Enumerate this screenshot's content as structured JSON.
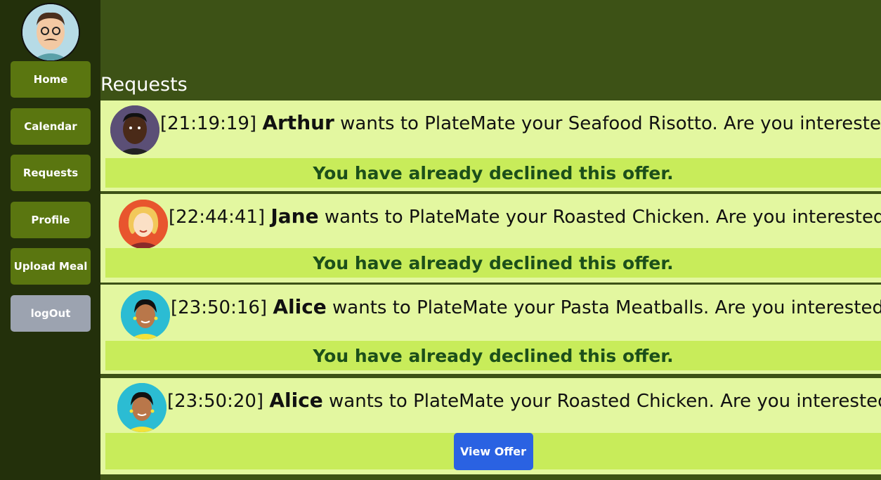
{
  "sidebar": {
    "nav": [
      {
        "label": "Home"
      },
      {
        "label": "Calendar"
      },
      {
        "label": "Requests"
      },
      {
        "label": "Profile"
      },
      {
        "label": "Upload Meal"
      },
      {
        "label": "logOut"
      }
    ]
  },
  "page": {
    "title": "Requests"
  },
  "requests": [
    {
      "time": "[21:19:19]",
      "name": "Arthur",
      "text": "wants to PlateMate your Seafood Risotto. Are you interested?",
      "status": "You have already declined this offer."
    },
    {
      "time": "[22:44:41]",
      "name": "Jane",
      "text": "wants to PlateMate your Roasted Chicken. Are you interested?",
      "status": "You have already declined this offer."
    },
    {
      "time": "[23:50:16]",
      "name": "Alice",
      "text": "wants to PlateMate your Pasta Meatballs. Are you interested?",
      "status": "You have already declined this offer."
    },
    {
      "time": "[23:50:20]",
      "name": "Alice",
      "text": "wants to PlateMate your Roasted Chicken. Are you interested?",
      "button": "View Offer"
    }
  ],
  "colors": {
    "sidebar": "#23300b",
    "header": "#3d5216",
    "nav_button": "#5a7610",
    "card": "#e3f7a0",
    "bar": "#c8ec5a",
    "declined_text": "#1c4f1a",
    "view_button": "#2a62e2"
  }
}
